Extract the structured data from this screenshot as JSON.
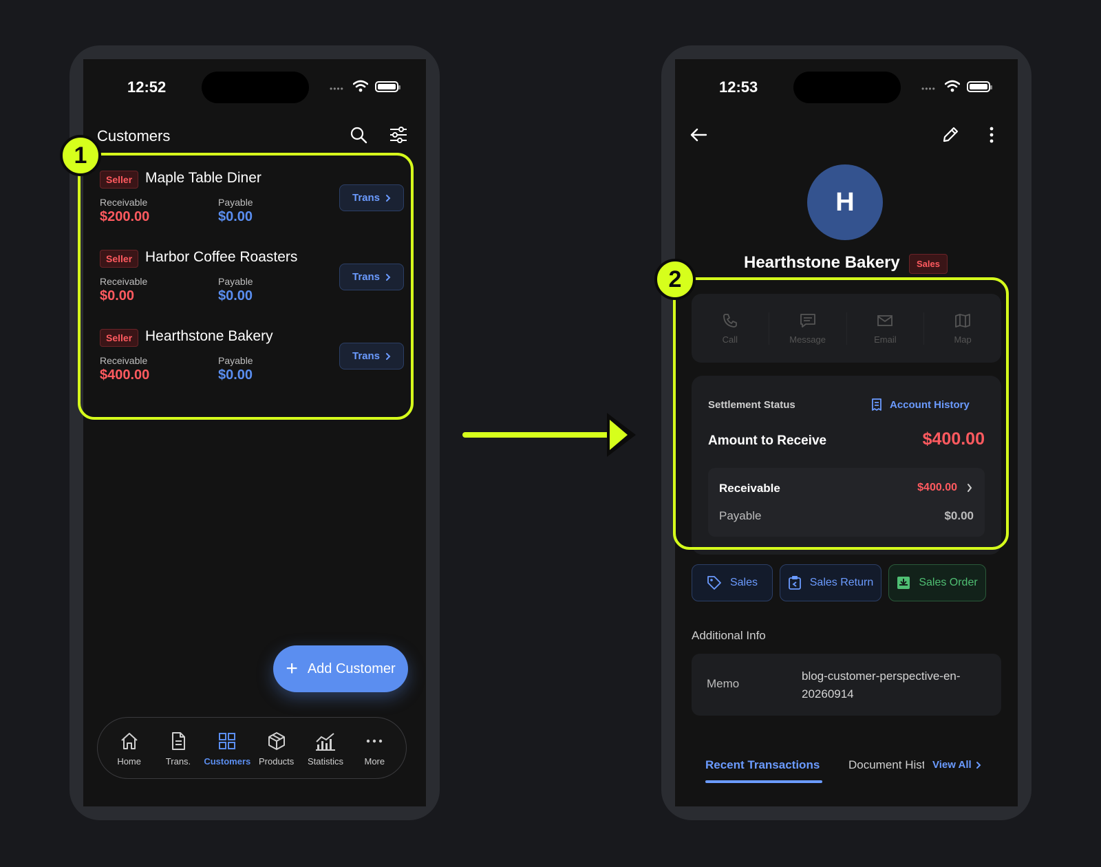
{
  "left_phone": {
    "status": {
      "time": "12:52"
    },
    "header": {
      "title": "Customers"
    },
    "customers": [
      {
        "badge": "Seller",
        "name": "Maple Table Diner",
        "receivable_label": "Receivable",
        "receivable": "$200.00",
        "payable_label": "Payable",
        "payable": "$0.00",
        "trans_label": "Trans"
      },
      {
        "badge": "Seller",
        "name": "Harbor Coffee Roasters",
        "receivable_label": "Receivable",
        "receivable": "$0.00",
        "payable_label": "Payable",
        "payable": "$0.00",
        "trans_label": "Trans"
      },
      {
        "badge": "Seller",
        "name": "Hearthstone Bakery",
        "receivable_label": "Receivable",
        "receivable": "$400.00",
        "payable_label": "Payable",
        "payable": "$0.00",
        "trans_label": "Trans"
      }
    ],
    "fab": {
      "label": "Add Customer"
    },
    "nav": [
      {
        "label": "Home",
        "icon": "home-icon"
      },
      {
        "label": "Trans.",
        "icon": "document-icon"
      },
      {
        "label": "Customers",
        "icon": "grid-icon",
        "active": true
      },
      {
        "label": "Products",
        "icon": "box-icon"
      },
      {
        "label": "Statistics",
        "icon": "chart-icon"
      },
      {
        "label": "More",
        "icon": "more-icon"
      }
    ]
  },
  "right_phone": {
    "status": {
      "time": "12:53"
    },
    "profile": {
      "initial": "H",
      "name": "Hearthstone Bakery",
      "badge": "Sales"
    },
    "contacts": [
      {
        "label": "Call",
        "icon": "phone-icon"
      },
      {
        "label": "Message",
        "icon": "message-icon"
      },
      {
        "label": "Email",
        "icon": "email-icon"
      },
      {
        "label": "Map",
        "icon": "map-icon"
      }
    ],
    "settlement": {
      "title": "Settlement Status",
      "history_label": "Account History",
      "amount_label": "Amount to Receive",
      "amount_value": "$400.00",
      "receivable_label": "Receivable",
      "receivable_value": "$400.00",
      "payable_label": "Payable",
      "payable_value": "$0.00"
    },
    "actions": {
      "sales": "Sales",
      "sales_return": "Sales Return",
      "sales_order": "Sales Order"
    },
    "additional": {
      "title": "Additional Info",
      "memo_label": "Memo",
      "memo_value": "blog-customer-perspective-en-20260914"
    },
    "tabs": {
      "recent": "Recent Transactions",
      "document": "Document History",
      "view_all": "View All"
    }
  },
  "annotations": {
    "step1": "1",
    "step2": "2",
    "highlight_color": "#d6ff1c"
  },
  "colors": {
    "accent": "#5b8ef0",
    "negative": "#ff5a5f",
    "positive": "#4fbf73"
  }
}
